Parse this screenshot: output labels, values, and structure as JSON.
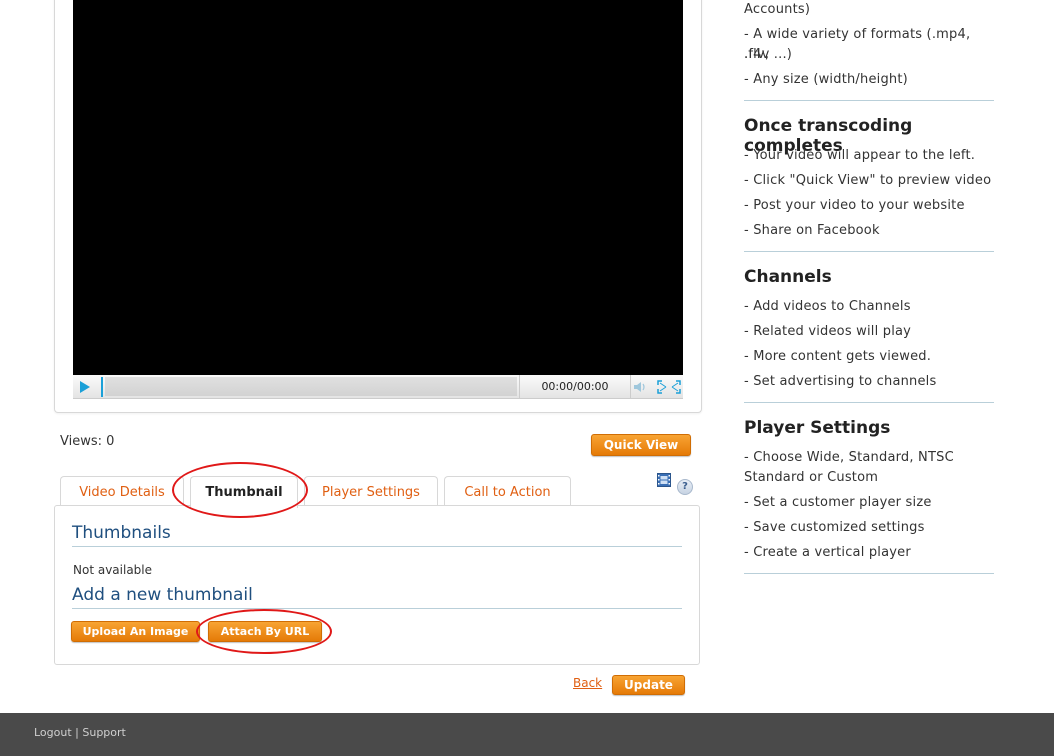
{
  "player": {
    "time": "00:00/00:00"
  },
  "views_text": "Views: 0",
  "quick_view_label": "Quick View",
  "tabs": [
    {
      "label": "Video Details"
    },
    {
      "label": "Thumbnail"
    },
    {
      "label": "Player Settings"
    },
    {
      "label": "Call to Action"
    }
  ],
  "help_label": "?",
  "panel": {
    "thumbnails_heading": "Thumbnails",
    "not_available": "Not available",
    "add_new_heading": "Add a new thumbnail",
    "upload_label": "Upload An Image",
    "attach_label": "Attach By URL"
  },
  "back_label": "Back",
  "update_label": "Update",
  "sidebar": {
    "top_lines": [
      "Accounts)",
      "- A wide variety of formats (.mp4, .flv,",
      ".f4v ...)",
      "- Any size (width/height)"
    ],
    "sections": [
      {
        "title": "Once transcoding completes",
        "items": [
          "- Your video will appear to the left.",
          "- Click \"Quick View\" to preview video",
          "- Post your video to your website",
          "- Share on Facebook"
        ]
      },
      {
        "title": "Channels",
        "items": [
          "- Add videos to Channels",
          "- Related videos will play",
          "- More content gets viewed.",
          "- Set advertising to channels"
        ]
      },
      {
        "title": "Player Settings",
        "items": [
          "- Choose Wide, Standard, NTSC",
          "Standard or Custom",
          "- Set a customer player size",
          "- Save customized settings",
          "- Create a vertical player"
        ]
      }
    ]
  },
  "footer": {
    "logout": "Logout",
    "separator": " | ",
    "support": "Support"
  },
  "colors": {
    "accent_orange": "#f08b1a",
    "tab_text": "#e05f12",
    "heading_blue": "#1f4f7f",
    "annotation_red": "#e01818",
    "footer_bg": "#4a4a4a"
  }
}
